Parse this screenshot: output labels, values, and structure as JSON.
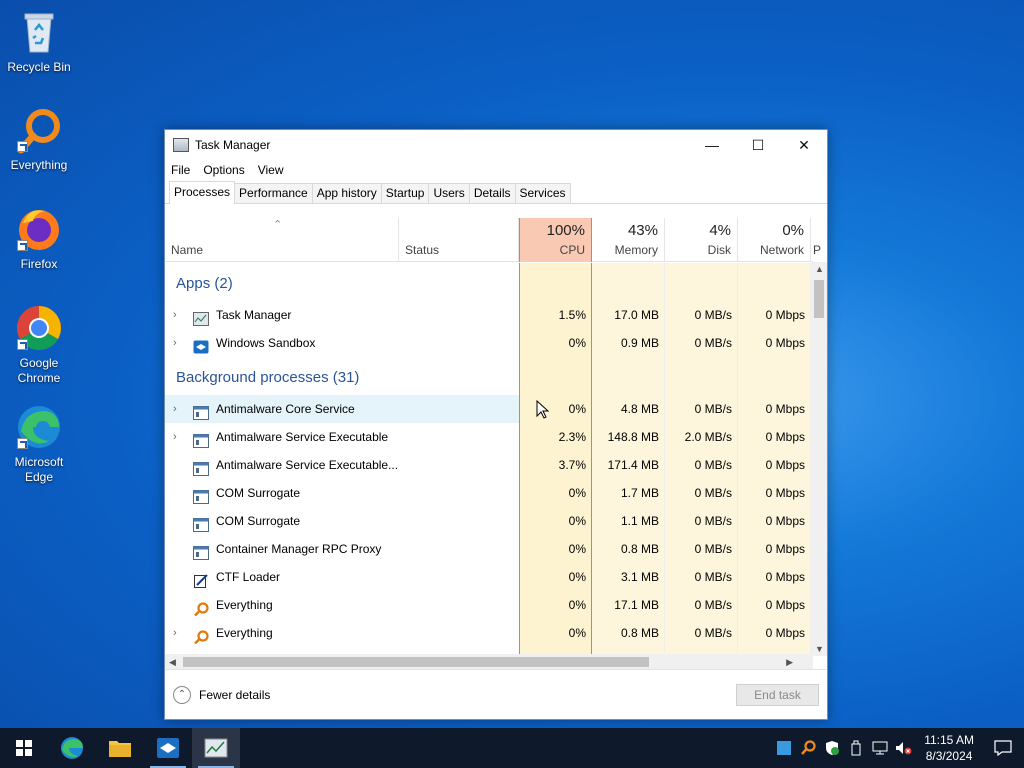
{
  "desktop": {
    "icons": [
      {
        "label": "Recycle Bin"
      },
      {
        "label": "Everything"
      },
      {
        "label": "Firefox"
      },
      {
        "label": "Google Chrome"
      },
      {
        "label": "Microsoft Edge"
      }
    ]
  },
  "window": {
    "title": "Task Manager",
    "controls": {
      "minimize": "—",
      "maximize": "☐",
      "close": "✕"
    },
    "menu": [
      "File",
      "Options",
      "View"
    ],
    "tabs": [
      "Processes",
      "Performance",
      "App history",
      "Startup",
      "Users",
      "Details",
      "Services"
    ],
    "active_tab": "Processes"
  },
  "columns": {
    "name": "Name",
    "status": "Status",
    "cpu": {
      "pct": "100%",
      "label": "CPU"
    },
    "memory": {
      "pct": "43%",
      "label": "Memory"
    },
    "disk": {
      "pct": "4%",
      "label": "Disk"
    },
    "network": {
      "pct": "0%",
      "label": "Network"
    },
    "power": "P"
  },
  "groups": {
    "apps": "Apps (2)",
    "background": "Background processes (31)"
  },
  "apps": [
    {
      "name": "Task Manager",
      "expand": "›",
      "cpu": "1.5%",
      "mem": "17.0 MB",
      "disk": "0 MB/s",
      "net": "0 Mbps"
    },
    {
      "name": "Windows Sandbox",
      "expand": "›",
      "cpu": "0%",
      "mem": "0.9 MB",
      "disk": "0 MB/s",
      "net": "0 Mbps"
    }
  ],
  "background": [
    {
      "name": "Antimalware Core Service",
      "expand": "›",
      "cpu": "0%",
      "mem": "4.8 MB",
      "disk": "0 MB/s",
      "net": "0 Mbps"
    },
    {
      "name": "Antimalware Service Executable",
      "expand": "›",
      "cpu": "2.3%",
      "mem": "148.8 MB",
      "disk": "2.0 MB/s",
      "net": "0 Mbps"
    },
    {
      "name": "Antimalware Service Executable...",
      "expand": "",
      "cpu": "3.7%",
      "mem": "171.4 MB",
      "disk": "0 MB/s",
      "net": "0 Mbps"
    },
    {
      "name": "COM Surrogate",
      "expand": "",
      "cpu": "0%",
      "mem": "1.7 MB",
      "disk": "0 MB/s",
      "net": "0 Mbps"
    },
    {
      "name": "COM Surrogate",
      "expand": "",
      "cpu": "0%",
      "mem": "1.1 MB",
      "disk": "0 MB/s",
      "net": "0 Mbps"
    },
    {
      "name": "Container Manager RPC Proxy",
      "expand": "",
      "cpu": "0%",
      "mem": "0.8 MB",
      "disk": "0 MB/s",
      "net": "0 Mbps"
    },
    {
      "name": "CTF Loader",
      "expand": "",
      "cpu": "0%",
      "mem": "3.1 MB",
      "disk": "0 MB/s",
      "net": "0 Mbps"
    },
    {
      "name": "Everything",
      "expand": "",
      "cpu": "0%",
      "mem": "17.1 MB",
      "disk": "0 MB/s",
      "net": "0 Mbps"
    },
    {
      "name": "Everything",
      "expand": "›",
      "cpu": "0%",
      "mem": "0.8 MB",
      "disk": "0 MB/s",
      "net": "0 Mbps"
    }
  ],
  "footer": {
    "fewer_details": "Fewer details",
    "end_task": "End task"
  },
  "taskbar": {
    "time": "11:15 AM",
    "date": "8/3/2024"
  },
  "colors": {
    "cpu_header": "#f9c9b3",
    "cpu_border": "#e47a54",
    "col_bg": "#fdf6dc",
    "group_title": "#2a5595",
    "taskbar": "#0e1a2b"
  }
}
